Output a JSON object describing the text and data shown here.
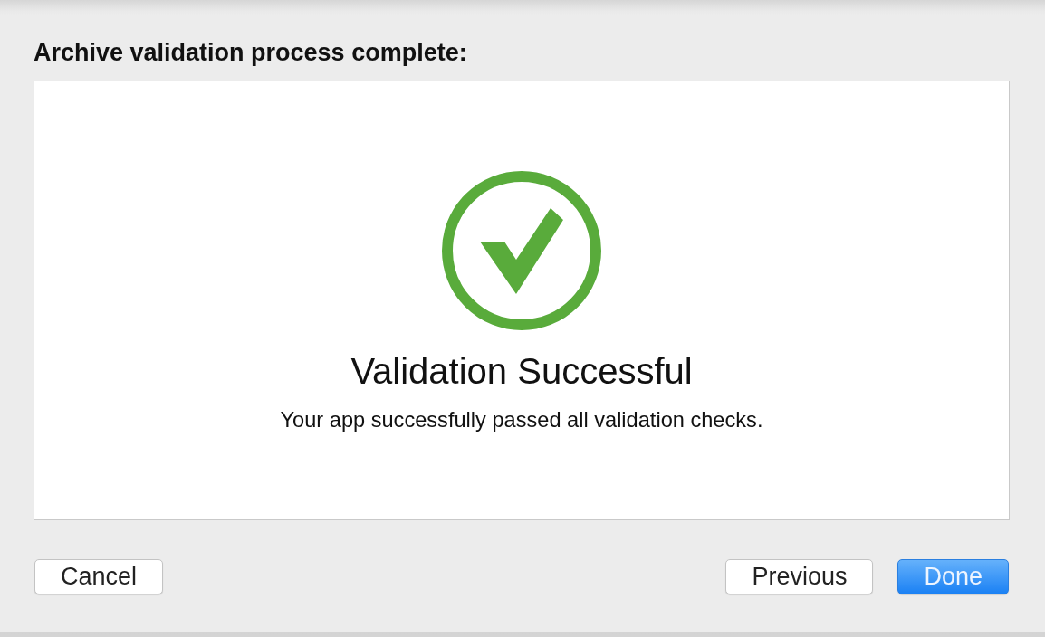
{
  "dialog": {
    "heading": "Archive validation process complete:",
    "result": {
      "passed": true,
      "title": "Validation Successful",
      "message": "Your app successfully passed all validation checks."
    }
  },
  "footer": {
    "left_buttons": [
      {
        "label": "Cancel",
        "default": false
      }
    ],
    "right_buttons": [
      {
        "label": "Previous",
        "default": false
      },
      {
        "label": "Done",
        "default": true
      }
    ]
  }
}
